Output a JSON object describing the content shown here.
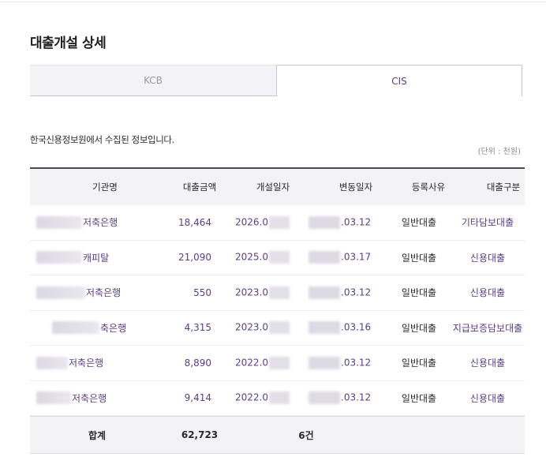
{
  "page": {
    "title": "대출개설 상세",
    "info_text": "한국신용정보원에서 수집된 정보입니다.",
    "unit_text": "(단위 : 천원)"
  },
  "tabs": [
    {
      "label": "KCB",
      "selected": false
    },
    {
      "label": "CIS",
      "selected": true
    }
  ],
  "colors": {
    "accent": "#5a3d86",
    "header_bg": "#f3f3f6",
    "border": "#c9c3d8"
  },
  "table": {
    "headers": [
      "기관명",
      "대출금액",
      "개설일자",
      "변동일자",
      "등록사유",
      "대출구분"
    ],
    "rows": [
      {
        "institution": "저축은행",
        "amount": "18,464",
        "open_date": "2026.0",
        "change_date": ".03.12",
        "reason": "일반대출",
        "type": "기타담보대출"
      },
      {
        "institution": "캐피탈",
        "amount": "21,090",
        "open_date": "2025.0",
        "change_date": ".03.17",
        "reason": "일반대출",
        "type": "신용대출"
      },
      {
        "institution": "저축은행",
        "amount": "550",
        "open_date": "2023.0",
        "change_date": ".03.12",
        "reason": "일반대출",
        "type": "신용대출"
      },
      {
        "institution": "축은행",
        "amount": "4,315",
        "open_date": "2023.0",
        "change_date": ".03.16",
        "reason": "일반대출",
        "type": "지급보증담보대출"
      },
      {
        "institution": "저축은행",
        "amount": "8,890",
        "open_date": "2022.0",
        "change_date": ".03.12",
        "reason": "일반대출",
        "type": "신용대출"
      },
      {
        "institution": "저축은행",
        "amount": "9,414",
        "open_date": "2022.0",
        "change_date": ".03.12",
        "reason": "일반대출",
        "type": "신용대출"
      }
    ],
    "footer": {
      "label": "합계",
      "amount": "62,723",
      "count": "6건"
    }
  }
}
